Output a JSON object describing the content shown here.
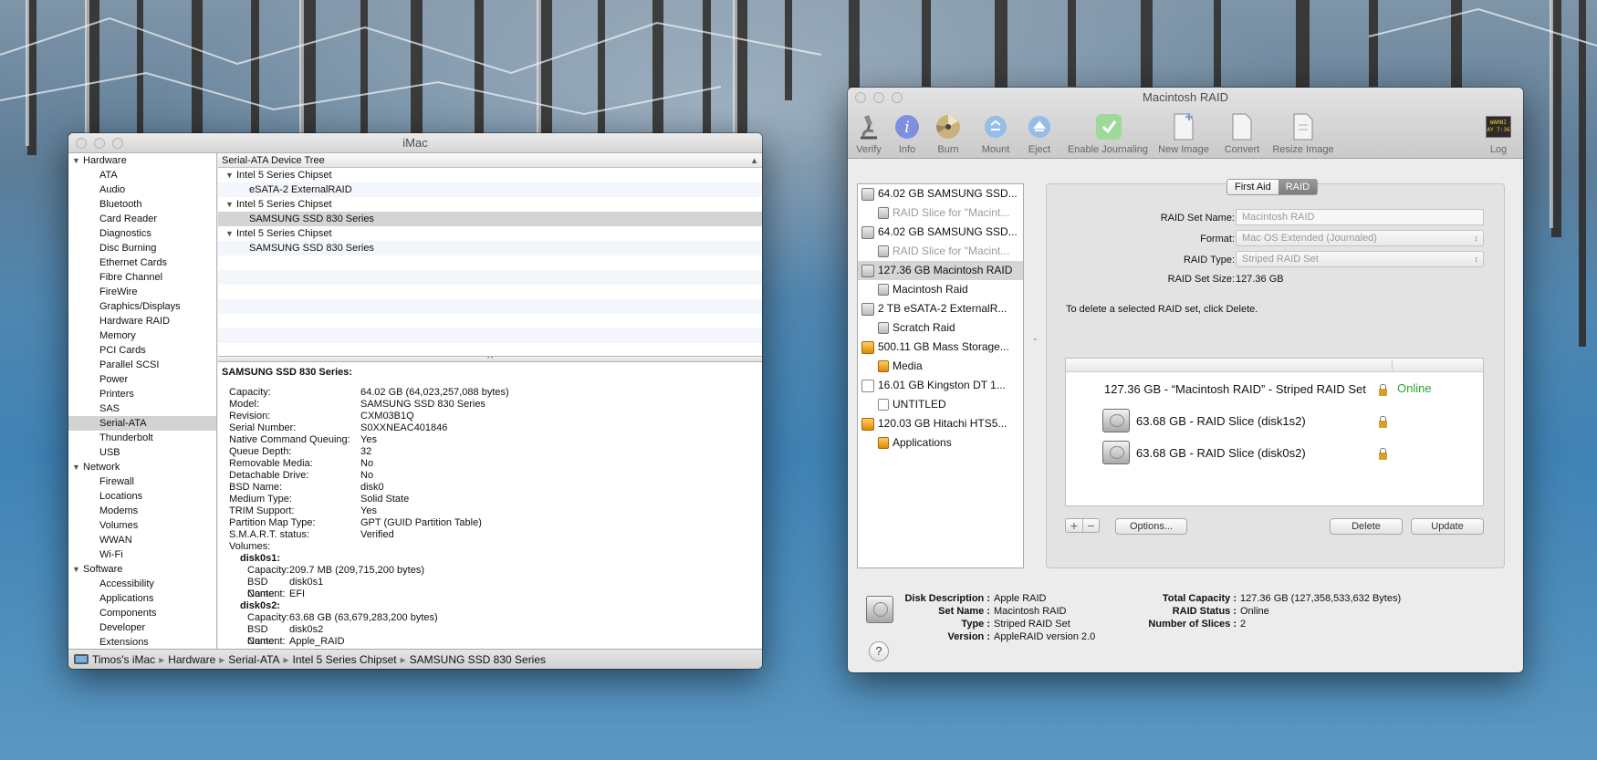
{
  "sysinfo": {
    "title": "iMac",
    "sidebar": [
      {
        "label": "Hardware",
        "type": "cat"
      },
      {
        "label": "ATA",
        "type": "sub"
      },
      {
        "label": "Audio",
        "type": "sub"
      },
      {
        "label": "Bluetooth",
        "type": "sub"
      },
      {
        "label": "Card Reader",
        "type": "sub"
      },
      {
        "label": "Diagnostics",
        "type": "sub"
      },
      {
        "label": "Disc Burning",
        "type": "sub"
      },
      {
        "label": "Ethernet Cards",
        "type": "sub"
      },
      {
        "label": "Fibre Channel",
        "type": "sub"
      },
      {
        "label": "FireWire",
        "type": "sub"
      },
      {
        "label": "Graphics/Displays",
        "type": "sub"
      },
      {
        "label": "Hardware RAID",
        "type": "sub"
      },
      {
        "label": "Memory",
        "type": "sub"
      },
      {
        "label": "PCI Cards",
        "type": "sub"
      },
      {
        "label": "Parallel SCSI",
        "type": "sub"
      },
      {
        "label": "Power",
        "type": "sub"
      },
      {
        "label": "Printers",
        "type": "sub"
      },
      {
        "label": "SAS",
        "type": "sub"
      },
      {
        "label": "Serial-ATA",
        "type": "sub",
        "selected": true
      },
      {
        "label": "Thunderbolt",
        "type": "sub"
      },
      {
        "label": "USB",
        "type": "sub"
      },
      {
        "label": "Network",
        "type": "cat"
      },
      {
        "label": "Firewall",
        "type": "sub"
      },
      {
        "label": "Locations",
        "type": "sub"
      },
      {
        "label": "Modems",
        "type": "sub"
      },
      {
        "label": "Volumes",
        "type": "sub"
      },
      {
        "label": "WWAN",
        "type": "sub"
      },
      {
        "label": "Wi-Fi",
        "type": "sub"
      },
      {
        "label": "Software",
        "type": "cat"
      },
      {
        "label": "Accessibility",
        "type": "sub"
      },
      {
        "label": "Applications",
        "type": "sub"
      },
      {
        "label": "Components",
        "type": "sub"
      },
      {
        "label": "Developer",
        "type": "sub"
      },
      {
        "label": "Extensions",
        "type": "sub"
      }
    ],
    "tree_header": "Serial-ATA Device Tree",
    "tree": [
      {
        "label": "Intel 5 Series Chipset",
        "level": 0
      },
      {
        "label": "eSATA-2 ExternalRAID",
        "level": 1
      },
      {
        "label": "Intel 5 Series Chipset",
        "level": 0
      },
      {
        "label": "SAMSUNG SSD 830 Series",
        "level": 1,
        "selected": true
      },
      {
        "label": "Intel 5 Series Chipset",
        "level": 0
      },
      {
        "label": "SAMSUNG SSD 830 Series",
        "level": 1
      }
    ],
    "details_title": "SAMSUNG SSD 830 Series:",
    "details": [
      {
        "k": "Capacity:",
        "v": "64.02 GB (64,023,257,088 bytes)"
      },
      {
        "k": "Model:",
        "v": "SAMSUNG SSD 830 Series"
      },
      {
        "k": "Revision:",
        "v": "CXM03B1Q"
      },
      {
        "k": "Serial Number:",
        "v": "S0XXNEAC401846"
      },
      {
        "k": "Native Command Queuing:",
        "v": "Yes"
      },
      {
        "k": "Queue Depth:",
        "v": "32"
      },
      {
        "k": "Removable Media:",
        "v": "No"
      },
      {
        "k": "Detachable Drive:",
        "v": "No"
      },
      {
        "k": "BSD Name:",
        "v": "disk0"
      },
      {
        "k": "Medium Type:",
        "v": "Solid State"
      },
      {
        "k": "TRIM Support:",
        "v": "Yes"
      },
      {
        "k": "Partition Map Type:",
        "v": "GPT (GUID Partition Table)"
      },
      {
        "k": "S.M.A.R.T. status:",
        "v": "Verified"
      }
    ],
    "volumes_label": "Volumes:",
    "volumes": [
      {
        "name": "disk0s1:",
        "rows": [
          {
            "k": "Capacity:",
            "v": "209.7 MB (209,715,200 bytes)"
          },
          {
            "k": "BSD Name:",
            "v": "disk0s1"
          },
          {
            "k": "Content:",
            "v": "EFI"
          }
        ]
      },
      {
        "name": "disk0s2:",
        "rows": [
          {
            "k": "Capacity:",
            "v": "63.68 GB (63,679,283,200 bytes)"
          },
          {
            "k": "BSD Name:",
            "v": "disk0s2"
          },
          {
            "k": "Content:",
            "v": "Apple_RAID"
          }
        ]
      }
    ],
    "path": [
      "Timos's iMac",
      "Hardware",
      "Serial-ATA",
      "Intel 5 Series Chipset",
      "SAMSUNG SSD 830 Series"
    ]
  },
  "diskutil": {
    "title": "Macintosh RAID",
    "toolbar": [
      {
        "label": "Verify",
        "icon": "microscope-icon"
      },
      {
        "label": "Info",
        "icon": "info-icon"
      },
      {
        "label": "Burn",
        "icon": "burn-icon"
      },
      {
        "label": "Mount",
        "icon": "mount-icon"
      },
      {
        "label": "Eject",
        "icon": "eject-icon"
      },
      {
        "label": "Enable Journaling",
        "icon": "journaling-icon"
      },
      {
        "label": "New Image",
        "icon": "new-image-icon"
      },
      {
        "label": "Convert",
        "icon": "convert-icon"
      },
      {
        "label": "Resize Image",
        "icon": "resize-image-icon"
      },
      {
        "label": "Log",
        "icon": "log-icon"
      }
    ],
    "log_icon_text": "WARNI\nAY 7:36",
    "disks": [
      {
        "label": "64.02 GB SAMSUNG SSD...",
        "kind": "disk",
        "icon": "gray"
      },
      {
        "label": "RAID Slice for \"Macint...",
        "kind": "vol",
        "dim": true,
        "icon": "gray"
      },
      {
        "label": "64.02 GB SAMSUNG SSD...",
        "kind": "disk",
        "icon": "gray"
      },
      {
        "label": "RAID Slice for \"Macint...",
        "kind": "vol",
        "dim": true,
        "icon": "gray"
      },
      {
        "label": "127.36 GB Macintosh RAID",
        "kind": "disk",
        "selected": true,
        "icon": "gray"
      },
      {
        "label": "Macintosh Raid",
        "kind": "vol",
        "icon": "gray"
      },
      {
        "label": "2 TB eSATA-2 ExternalR...",
        "kind": "disk",
        "icon": "gray"
      },
      {
        "label": "Scratch Raid",
        "kind": "vol",
        "icon": "gray"
      },
      {
        "label": "500.11 GB Mass Storage...",
        "kind": "disk",
        "icon": "orange"
      },
      {
        "label": "Media",
        "kind": "vol",
        "icon": "orange"
      },
      {
        "label": "16.01 GB Kingston DT 1...",
        "kind": "disk",
        "icon": "white"
      },
      {
        "label": "UNTITLED",
        "kind": "vol",
        "icon": "white"
      },
      {
        "label": "120.03 GB Hitachi HTS5...",
        "kind": "disk",
        "icon": "orange"
      },
      {
        "label": "Applications",
        "kind": "vol",
        "icon": "orange"
      }
    ],
    "tabs": [
      "First Aid",
      "RAID"
    ],
    "form": {
      "name_label": "RAID Set Name:",
      "name_value": "Macintosh RAID",
      "format_label": "Format:",
      "format_value": "Mac OS Extended (Journaled)",
      "type_label": "RAID Type:",
      "type_value": "Striped RAID Set",
      "size_label": "RAID Set Size:",
      "size_value": "127.36 GB"
    },
    "note": "To delete a selected RAID set, click Delete.",
    "raid_set": {
      "label": "127.36 GB - “Macintosh RAID” - Striped RAID Set",
      "status": "Online",
      "status_color": "#2ea12e"
    },
    "slices": [
      {
        "label": "63.68 GB - RAID Slice (disk1s2)"
      },
      {
        "label": "63.68 GB - RAID Slice (disk0s2)"
      }
    ],
    "buttons": {
      "plus": "+",
      "minus": "−",
      "options": "Options...",
      "delete": "Delete",
      "update": "Update"
    },
    "info_left": [
      {
        "k": "Disk Description :",
        "v": "Apple RAID"
      },
      {
        "k": "Set Name :",
        "v": "Macintosh RAID"
      },
      {
        "k": "Type :",
        "v": "Striped RAID Set"
      },
      {
        "k": "Version :",
        "v": "AppleRAID version 2.0"
      }
    ],
    "info_right": [
      {
        "k": "Total Capacity :",
        "v": "127.36 GB (127,358,533,632 Bytes)"
      },
      {
        "k": "RAID Status :",
        "v": "Online"
      },
      {
        "k": "Number of Slices :",
        "v": "2"
      }
    ],
    "help": "?"
  }
}
